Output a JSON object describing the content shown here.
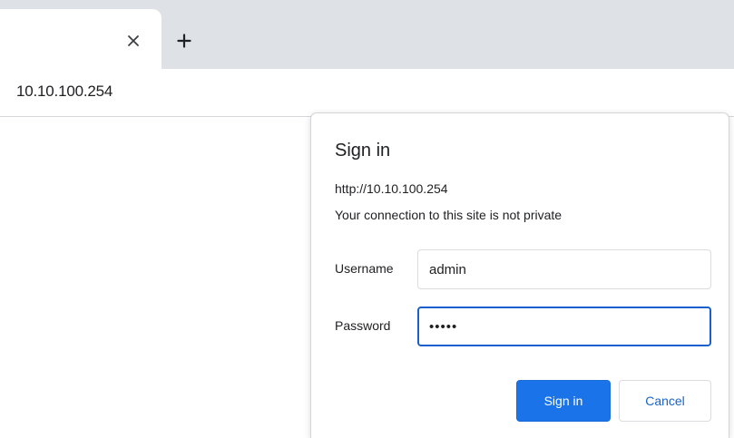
{
  "browser": {
    "tab": {
      "close_icon": "close-icon",
      "close_glyph": "×"
    },
    "new_tab": {
      "icon": "plus-icon",
      "glyph": "+"
    },
    "address_bar": {
      "url": "10.10.100.254"
    }
  },
  "dialog": {
    "title": "Sign in",
    "url": "http://10.10.100.254",
    "warning": "Your connection to this site is not private",
    "username": {
      "label": "Username",
      "value": "admin"
    },
    "password": {
      "label": "Password",
      "value": "•••••"
    },
    "buttons": {
      "sign_in": "Sign in",
      "cancel": "Cancel"
    }
  },
  "colors": {
    "tabstrip_bg": "#dee1e6",
    "primary_blue": "#1a73e8",
    "focus_ring": "#1a5fd0",
    "text": "#202124"
  }
}
